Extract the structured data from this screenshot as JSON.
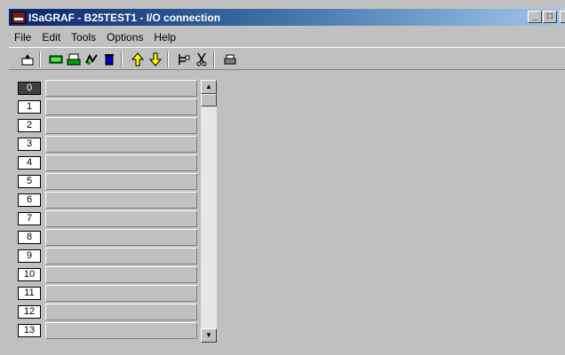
{
  "window": {
    "title": "ISaGRAF - B25TEST1 - I/O connection",
    "controls": {
      "minimize": "_",
      "maximize": "□",
      "close": "×"
    }
  },
  "menu": [
    "File",
    "Edit",
    "Tools",
    "Options",
    "Help"
  ],
  "toolbar": {
    "buttons": [
      "open-board-icon",
      "board-icon",
      "board-params-icon",
      "connect-icon",
      "delete-icon",
      "move-up-icon",
      "move-down-icon",
      "tree-icon",
      "cut-icon",
      "print-icon"
    ]
  },
  "slots": {
    "labels": [
      "0",
      "1",
      "2",
      "3",
      "4",
      "5",
      "6",
      "7",
      "8",
      "9",
      "10",
      "11",
      "12",
      "13"
    ],
    "selected_index": 0
  },
  "scrollbar": {
    "up": "▲",
    "down": "▼"
  },
  "colors": {
    "title_start": "#0a246a",
    "title_end": "#a6caf0",
    "face": "#c0c0c0"
  }
}
